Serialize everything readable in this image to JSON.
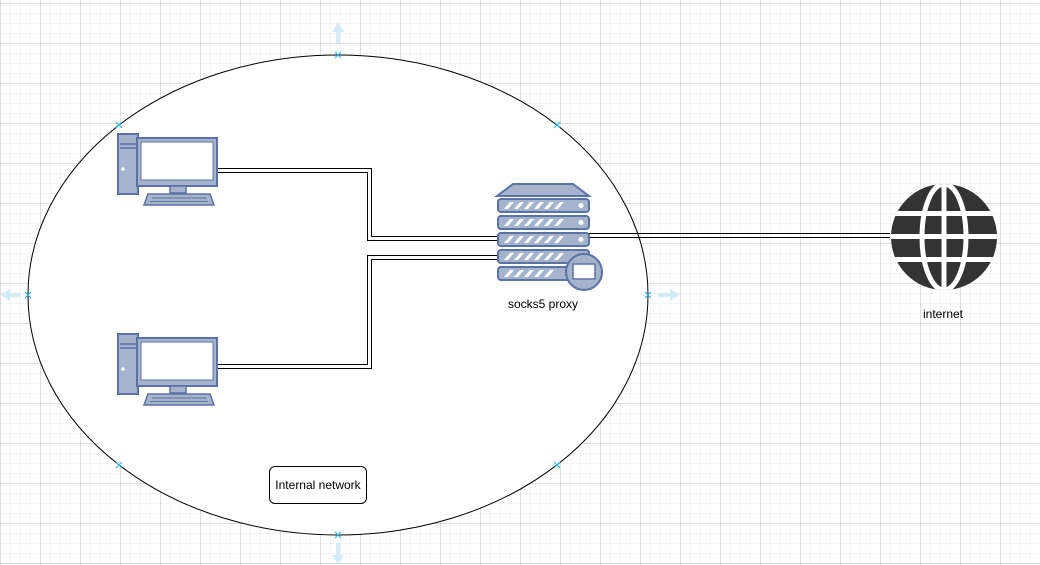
{
  "nodes": {
    "pc_top": {
      "kind": "desktop-computer-icon"
    },
    "pc_bottom": {
      "kind": "desktop-computer-icon"
    },
    "proxy": {
      "kind": "proxy-server-icon",
      "label": "socks5 proxy"
    },
    "internet": {
      "kind": "globe-icon",
      "label": "internet"
    }
  },
  "group": {
    "kind": "ellipse",
    "label": "Internal network"
  },
  "edges": [
    {
      "from": "pc_top",
      "to": "proxy",
      "style": "double-line"
    },
    {
      "from": "pc_bottom",
      "to": "proxy",
      "style": "double-line"
    },
    {
      "from": "proxy",
      "to": "internet",
      "style": "double-line"
    }
  ],
  "colors": {
    "icon_fill": "#a5b3cc",
    "icon_stroke": "#5b72a4",
    "screen": "#ffffff",
    "globe": "#333333",
    "selection": "#29b6f2"
  }
}
